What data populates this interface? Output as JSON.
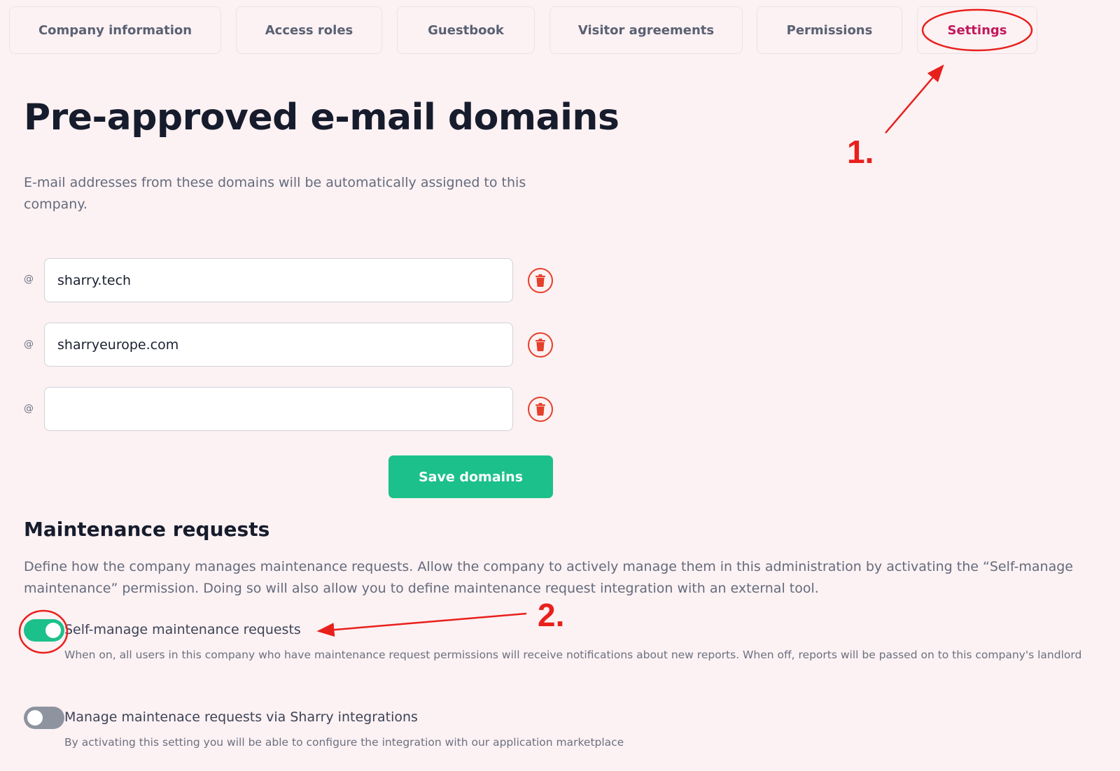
{
  "tabs": [
    {
      "label": "Company information",
      "active": false
    },
    {
      "label": "Access roles",
      "active": false
    },
    {
      "label": "Guestbook",
      "active": false
    },
    {
      "label": "Visitor agreements",
      "active": false
    },
    {
      "label": "Permissions",
      "active": false
    },
    {
      "label": "Settings",
      "active": true
    }
  ],
  "domains_section": {
    "title": "Pre-approved e-mail domains",
    "description": "E-mail addresses from these domains will be automatically assigned to this company.",
    "at_symbol": "@",
    "domains": [
      "sharry.tech",
      "sharryeurope.com",
      ""
    ],
    "save_label": "Save domains"
  },
  "maintenance": {
    "title": "Maintenance requests",
    "description": "Define how the company manages maintenance requests. Allow the company to actively manage them in this administration by activating the “Self-manage maintenance” permission. Doing so will also allow you to define maintenance request integration with an external tool.",
    "toggles": [
      {
        "label": "Self-manage maintenance requests",
        "help": "When on, all users in this company who have maintenance request permissions will receive notifications about new reports. When off, reports will be passed on to this company's landlord",
        "on": true
      },
      {
        "label": "Manage maintenace requests via Sharry integrations",
        "help": "By activating this setting you will be able to configure the integration with our application marketplace",
        "on": false
      }
    ]
  },
  "annotations": {
    "step1": "1.",
    "step2": "2.",
    "color": "#e8201c"
  },
  "colors": {
    "accent_green": "#1cc08a",
    "active_tab": "#c2185b",
    "delete_red": "#e5402b",
    "background": "#fcf1f3"
  }
}
